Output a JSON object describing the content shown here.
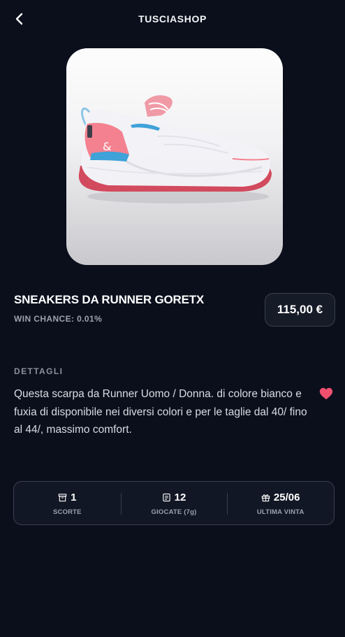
{
  "header": {
    "title": "TUSCIASHOP",
    "back_icon": "chevron-left-icon"
  },
  "product": {
    "image_alt": "sneaker",
    "name": "SNEAKERS DA RUNNER GORETX",
    "win_chance": "WIN CHANCE: 0.01%",
    "price": "115,00 €"
  },
  "details": {
    "label": "DETTAGLI",
    "description": "Questa scarpa da Runner Uomo / Donna. di colore bianco e fuxia di  disponibile nei diversi colori e per le taglie dal 40/ fino al 44/, massimo comfort.",
    "favorite_icon": "heart-icon",
    "favorite_color": "#f0506e"
  },
  "stats": [
    {
      "icon": "box-icon",
      "value": "1",
      "label": "SCORTE"
    },
    {
      "icon": "receipt-icon",
      "value": "12",
      "label": "GIOCATE (7g)"
    },
    {
      "icon": "gift-icon",
      "value": "25/06",
      "label": "ULTIMA VINTA"
    }
  ],
  "colors": {
    "background": "#0b0f1c",
    "card_border": "#3a4050",
    "muted_text": "#9ba1ad"
  }
}
